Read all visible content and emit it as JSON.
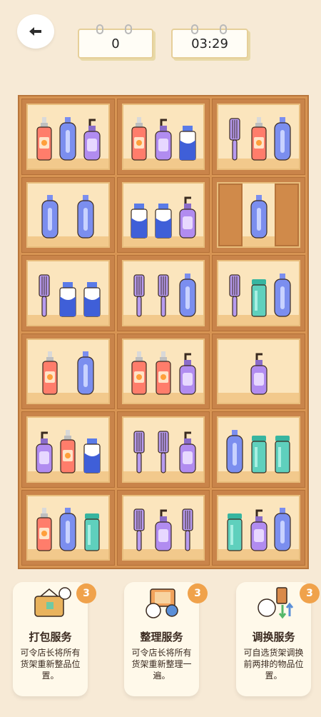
{
  "header": {
    "back_icon": "arrow-left-icon",
    "score": "0",
    "timer": "03:29"
  },
  "shelves": [
    {
      "items": [
        "spray-bottle",
        "shampoo",
        "pump-bottle"
      ]
    },
    {
      "items": [
        "spray-bottle",
        "pump-bottle",
        "milk-carton"
      ]
    },
    {
      "items": [
        "comb",
        "spray-bottle",
        "shampoo"
      ]
    },
    {
      "items": [
        "shampoo",
        "shampoo"
      ]
    },
    {
      "items": [
        "milk-carton",
        "milk-carton",
        "pump-bottle"
      ]
    },
    {
      "items": [
        "shampoo"
      ],
      "doors": true
    },
    {
      "items": [
        "comb",
        "milk-carton",
        "milk-carton"
      ]
    },
    {
      "items": [
        "comb",
        "comb",
        "shampoo"
      ]
    },
    {
      "items": [
        "comb",
        "tube-jar",
        "shampoo"
      ]
    },
    {
      "items": [
        "spray-bottle",
        "shampoo"
      ]
    },
    {
      "items": [
        "spray-bottle",
        "spray-bottle",
        "pump-bottle"
      ]
    },
    {
      "items": [
        "pump-bottle"
      ]
    },
    {
      "items": [
        "pump-bottle",
        "spray-bottle",
        "milk-carton"
      ]
    },
    {
      "items": [
        "comb",
        "comb",
        "pump-bottle"
      ]
    },
    {
      "items": [
        "shampoo",
        "tube-jar",
        "tube-jar"
      ]
    },
    {
      "items": [
        "spray-bottle",
        "shampoo",
        "tube-jar"
      ]
    },
    {
      "items": [
        "comb",
        "pump-bottle",
        "comb"
      ]
    },
    {
      "items": [
        "tube-jar",
        "pump-bottle",
        "shampoo"
      ]
    }
  ],
  "powerups": [
    {
      "icon": "package-icon",
      "count": "3",
      "title": "打包服务",
      "desc": "可令店长将所有货架重新整品位置。"
    },
    {
      "icon": "shuffle-icon",
      "count": "3",
      "title": "整理服务",
      "desc": "可令店长将所有货架重新整理一遍。"
    },
    {
      "icon": "swap-icon",
      "count": "3",
      "title": "调换服务",
      "desc": "可自选货架调换前两排的物品位置。"
    }
  ],
  "colors": {
    "background": "#f7ead6",
    "shelf_wood": "#d79453",
    "badge": "#f0a24b"
  }
}
